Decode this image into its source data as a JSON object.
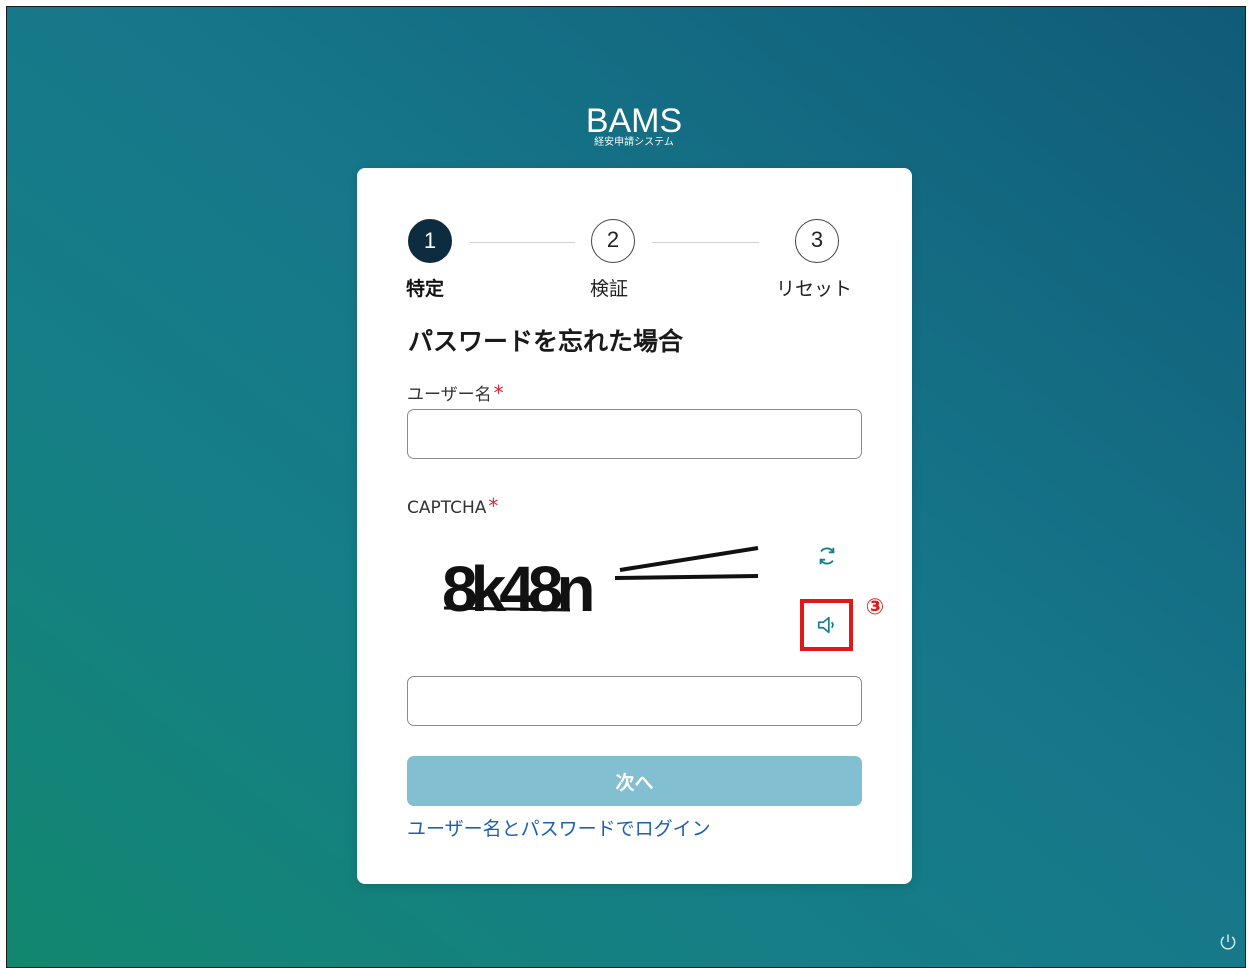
{
  "brand": {
    "name": "BAMS",
    "subtitle": "経安申請システム"
  },
  "steps": [
    {
      "number": "1",
      "label": "特定",
      "state": "active"
    },
    {
      "number": "2",
      "label": "検証",
      "state": "idle"
    },
    {
      "number": "3",
      "label": "リセット",
      "state": "idle"
    }
  ],
  "form": {
    "title": "パスワードを忘れた場合",
    "username": {
      "label": "ユーザー名",
      "required_mark": "*",
      "value": "",
      "placeholder": ""
    },
    "captcha": {
      "label": "CAPTCHA",
      "required_mark": "*",
      "image_text": "8k48n",
      "value": "",
      "placeholder": ""
    },
    "next_button": "次へ",
    "login_link": "ユーザー名とパスワードでログイン"
  },
  "annotation": {
    "marker": "③"
  },
  "icons": {
    "refresh": "refresh-icon",
    "audio": "speaker-icon",
    "corner": "power-icon"
  },
  "colors": {
    "step_active": "#0d2c3f",
    "required": "#e0223a",
    "next_button": "#82bfd0",
    "link": "#1d5fb2",
    "highlight": "#e01818"
  }
}
